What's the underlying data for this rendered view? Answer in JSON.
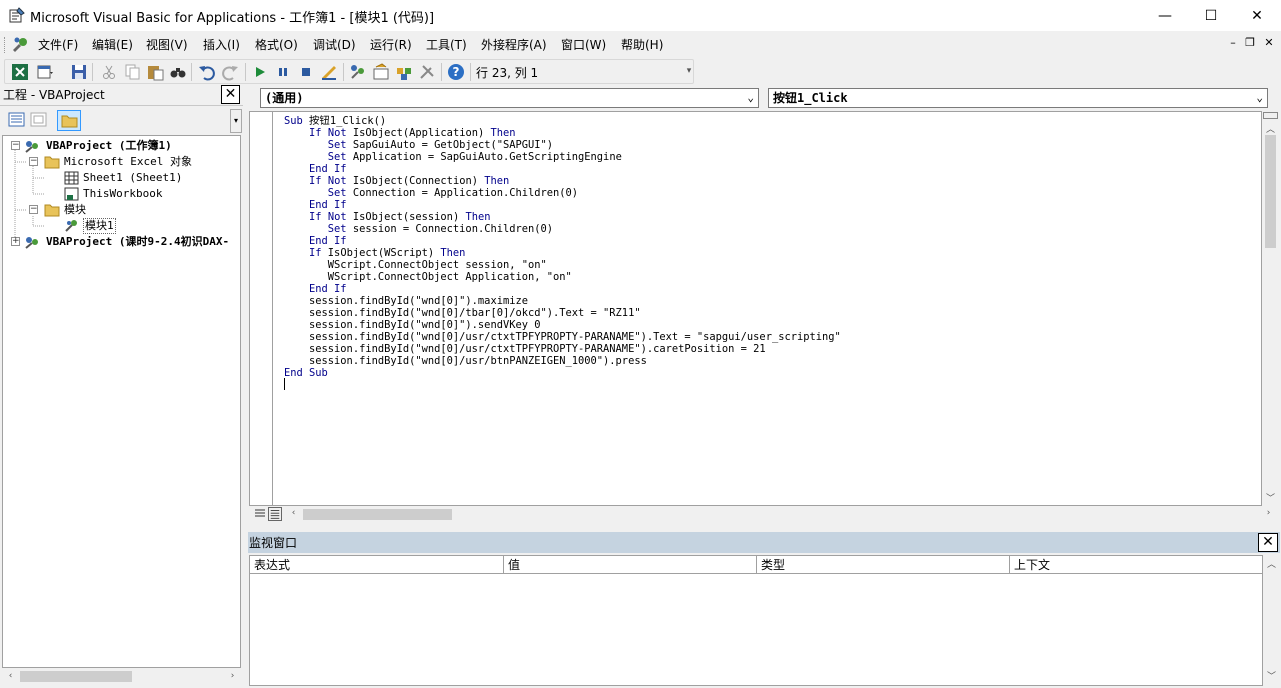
{
  "window": {
    "title": "Microsoft Visual Basic for Applications - 工作簿1 - [模块1 (代码)]",
    "minimize": "—",
    "maximize": "☐",
    "close": "✕"
  },
  "menu": {
    "items": [
      "文件(F)",
      "编辑(E)",
      "视图(V)",
      "插入(I)",
      "格式(O)",
      "调试(D)",
      "运行(R)",
      "工具(T)",
      "外接程序(A)",
      "窗口(W)",
      "帮助(H)"
    ],
    "mdi_minimize": "–",
    "mdi_restore": "❐",
    "mdi_close": "✕"
  },
  "toolbar": {
    "cursor_position": "行 23, 列 1",
    "icons": [
      "excel-icon",
      "insert-userform-icon",
      "save-icon",
      "cut-icon",
      "copy-icon",
      "paste-icon",
      "find-icon",
      "undo-icon",
      "redo-icon",
      "run-icon",
      "break-icon",
      "reset-icon",
      "design-mode-icon",
      "project-explorer-icon",
      "properties-icon",
      "object-browser-icon",
      "toolbox-icon",
      "help-icon"
    ]
  },
  "project_pane": {
    "title": "工程 - VBAProject",
    "tree": [
      {
        "label": "VBAProject (工作簿1)",
        "bold": true
      },
      {
        "label": "Microsoft Excel 对象"
      },
      {
        "label": "Sheet1 (Sheet1)"
      },
      {
        "label": "ThisWorkbook"
      },
      {
        "label": "模块"
      },
      {
        "label": "模块1"
      },
      {
        "label": "VBAProject (课时9-2.4初识DAX-",
        "bold": true
      }
    ]
  },
  "code_window": {
    "object_combo": "(通用)",
    "procedure_combo": "按钮1_Click",
    "lines": [
      "Sub 按钮1_Click()",
      "    If Not IsObject(Application) Then",
      "       Set SapGuiAuto = GetObject(\"SAPGUI\")",
      "       Set Application = SapGuiAuto.GetScriptingEngine",
      "    End If",
      "    If Not IsObject(Connection) Then",
      "       Set Connection = Application.Children(0)",
      "    End If",
      "    If Not IsObject(session) Then",
      "       Set session = Connection.Children(0)",
      "    End If",
      "    If IsObject(WScript) Then",
      "       WScript.ConnectObject session, \"on\"",
      "       WScript.ConnectObject Application, \"on\"",
      "    End If",
      "    session.findById(\"wnd[0]\").maximize",
      "    session.findById(\"wnd[0]/tbar[0]/okcd\").Text = \"RZ11\"",
      "    session.findById(\"wnd[0]\").sendVKey 0",
      "    session.findById(\"wnd[0]/usr/ctxtTPFYPROPTY-PARANAME\").Text = \"sapgui/user_scripting\"",
      "    session.findById(\"wnd[0]/usr/ctxtTPFYPROPTY-PARANAME\").caretPosition = 21",
      "    session.findById(\"wnd[0]/usr/btnPANZEIGEN_1000\").press",
      "End Sub",
      ""
    ]
  },
  "watch_window": {
    "title": "监视窗口",
    "columns": [
      "表达式",
      "值",
      "类型",
      "上下文"
    ]
  }
}
